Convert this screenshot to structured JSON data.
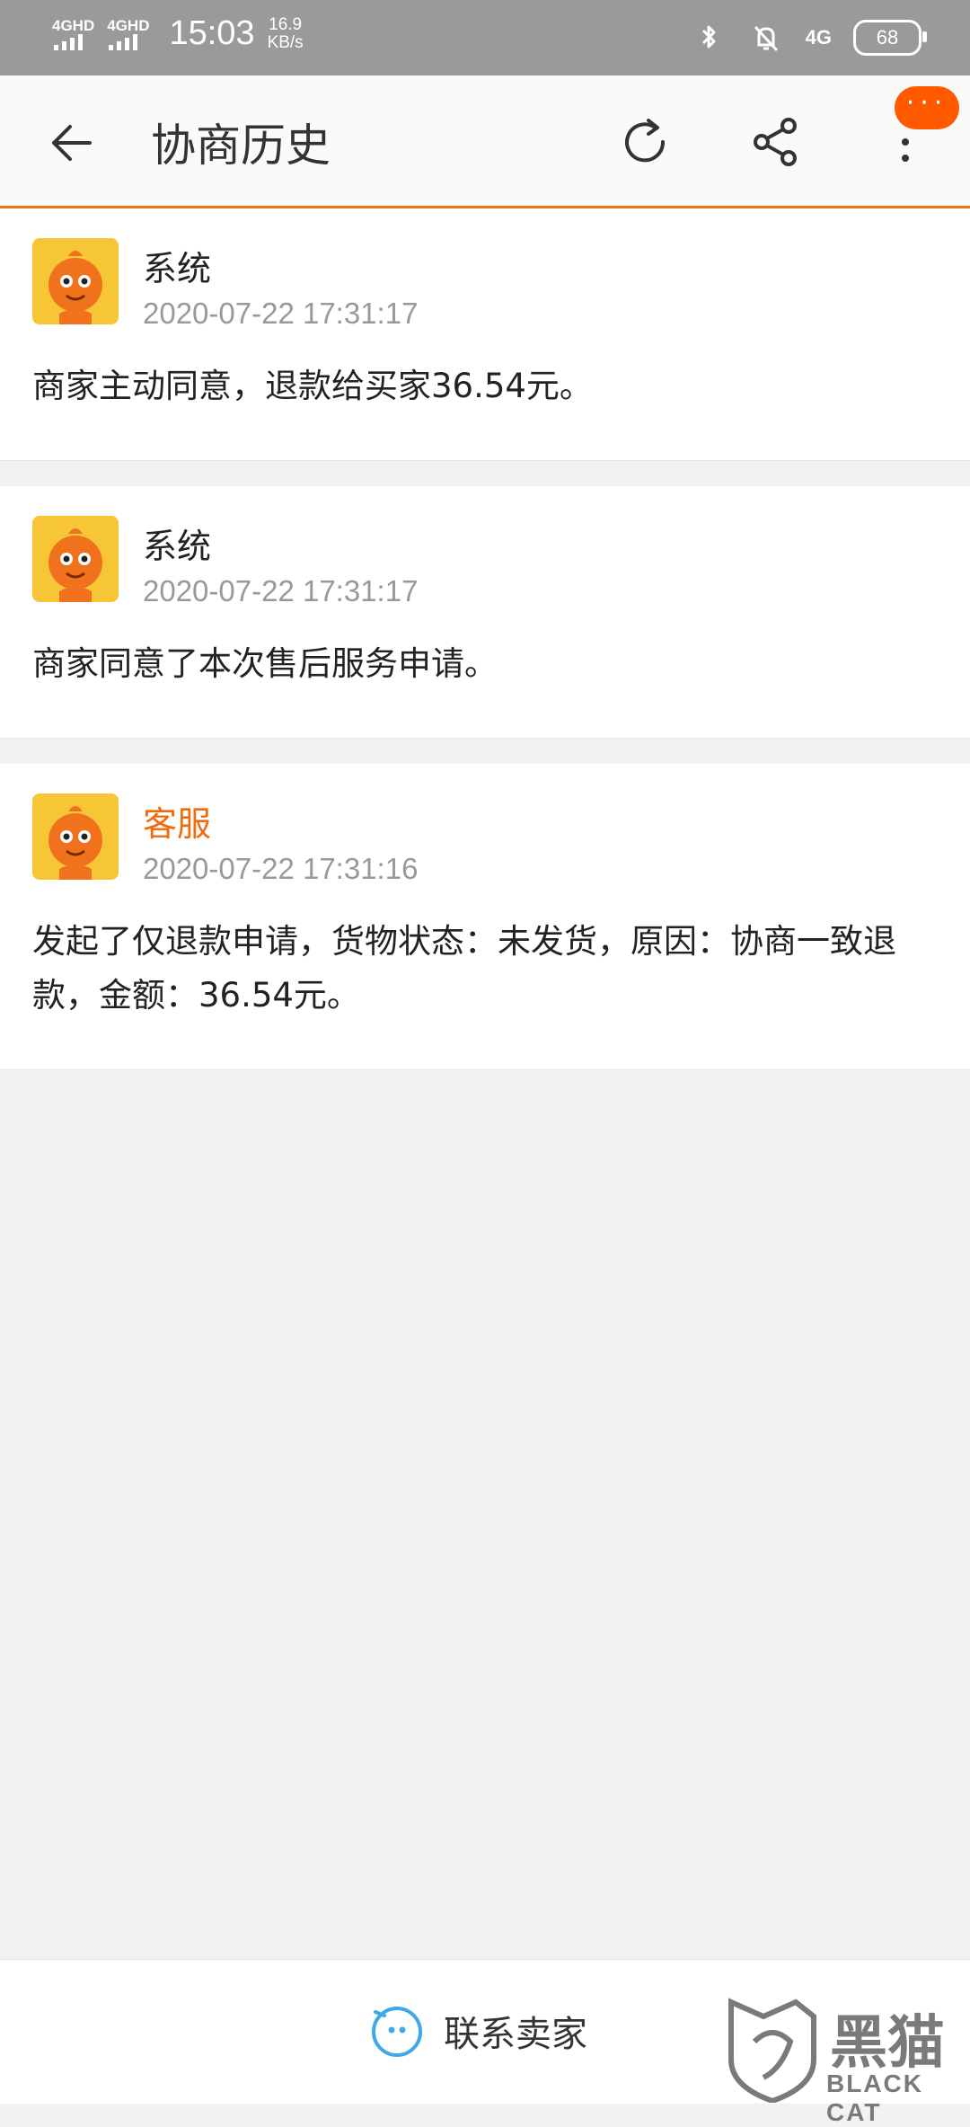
{
  "status_bar": {
    "signal_1": "4GHD",
    "signal_2": "4GHD",
    "time": "15:03",
    "speed_value": "16.9",
    "speed_unit": "KB/s",
    "network": "4G",
    "battery": "68"
  },
  "header": {
    "title": "协商历史",
    "badge_text": "···"
  },
  "records": [
    {
      "sender": "系统",
      "time": "2020-07-22 17:31:17",
      "message": "商家主动同意，退款给买家36.54元。"
    },
    {
      "sender": "系统",
      "time": "2020-07-22 17:31:17",
      "message": "商家同意了本次售后服务申请。"
    },
    {
      "sender": "客服",
      "time": "2020-07-22 17:31:16",
      "message": "发起了仅退款申请，货物状态：未发货，原因：协商一致退款，金额：36.54元。"
    }
  ],
  "bottom": {
    "contact_label": "联系卖家"
  },
  "watermark": {
    "text": "黑猫",
    "sub": "BLACK CAT"
  },
  "colors": {
    "accent": "#f0720c",
    "badge": "#ff5a00",
    "status_bar": "#9a9a9a"
  }
}
